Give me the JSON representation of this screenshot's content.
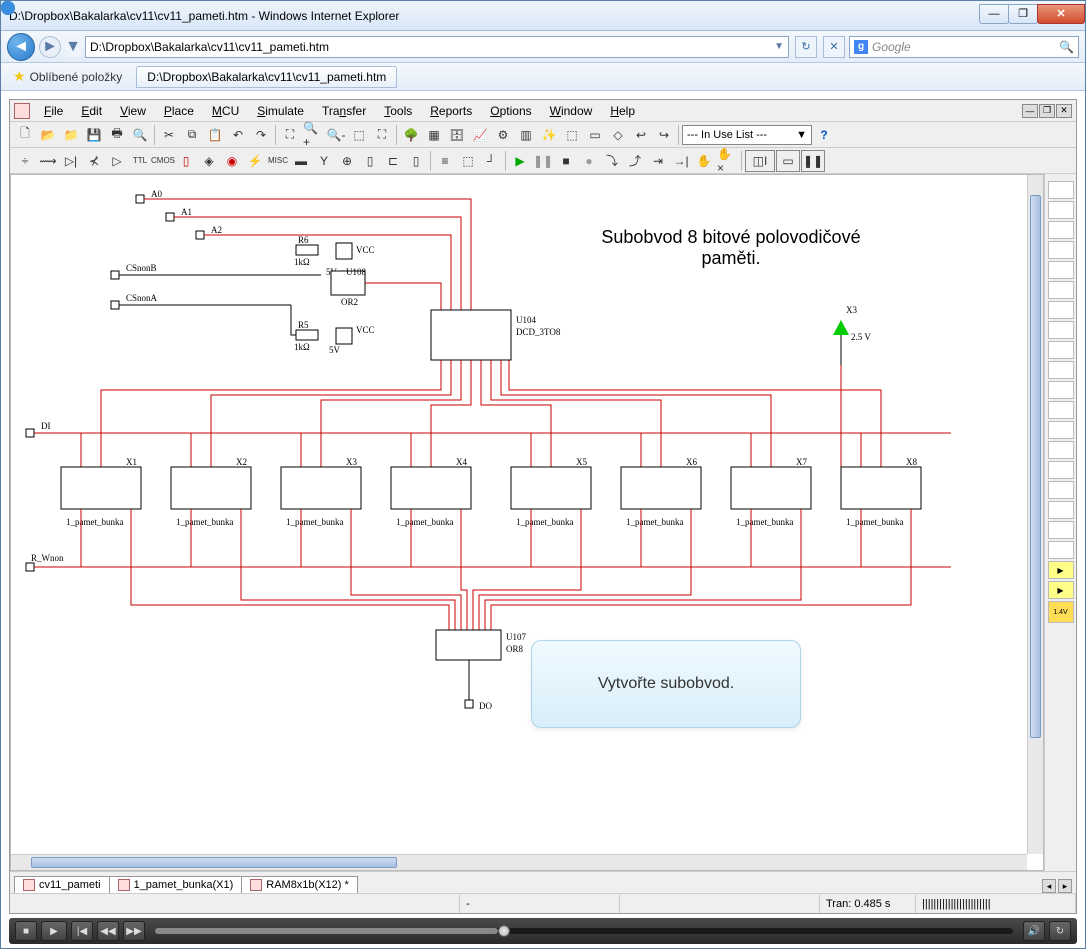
{
  "window": {
    "title": "D:\\Dropbox\\Bakalarka\\cv11\\cv11_pameti.htm - Windows Internet Explorer",
    "address": "D:\\Dropbox\\Bakalarka\\cv11\\cv11_pameti.htm",
    "search_placeholder": "Google"
  },
  "favbar": {
    "favorites": "Oblíbené položky",
    "tab_title": "D:\\Dropbox\\Bakalarka\\cv11\\cv11_pameti.htm"
  },
  "menus": [
    "File",
    "Edit",
    "View",
    "Place",
    "MCU",
    "Simulate",
    "Transfer",
    "Tools",
    "Reports",
    "Options",
    "Window",
    "Help"
  ],
  "toolbar": {
    "inuse": "--- In Use List ---"
  },
  "schematic": {
    "title_line1": "Subobvod 8 bitové polovodičové",
    "title_line2": "paměti.",
    "callout": "Vytvořte subobvod.",
    "signals": {
      "a0": "A0",
      "a1": "A1",
      "a2": "A2",
      "csnonb": "CSnonB",
      "csnona": "CSnonA",
      "di": "DI",
      "rwnon": "R_Wnon",
      "do": "DO"
    },
    "components": {
      "r5": {
        "ref": "R5",
        "val": "1kΩ"
      },
      "r6": {
        "ref": "R6",
        "val": "1kΩ"
      },
      "vcc1": "VCC",
      "vcc2": "VCC",
      "v5": "5V",
      "v5b": "5V",
      "u108": {
        "ref": "U108",
        "type": "OR2"
      },
      "u104": {
        "ref": "U104",
        "type": "DCD_3TO8"
      },
      "u107": {
        "ref": "U107",
        "type": "OR8"
      },
      "x3": {
        "ref": "X3",
        "val": "2.5 V"
      }
    },
    "cells": {
      "refs": [
        "X1",
        "X2",
        "X3",
        "X4",
        "X5",
        "X6",
        "X7",
        "X8"
      ],
      "label": "1_pamet_bunka"
    }
  },
  "doc_tabs": [
    "cv11_pameti",
    "1_pamet_bunka(X1)",
    "RAM8x1b(X12) *"
  ],
  "status": {
    "tran": "Tran: 0.485 s"
  }
}
